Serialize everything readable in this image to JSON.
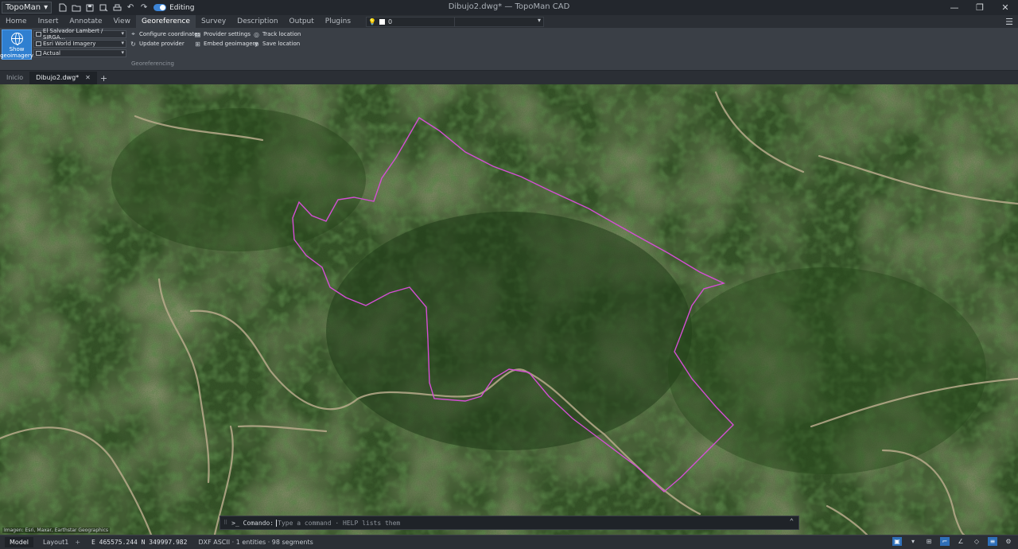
{
  "titlebar": {
    "app_menu": "TopoMan",
    "editing_label": "Editing",
    "window_title": "Dibujo2.dwg* — TopoMan CAD"
  },
  "ribbon_tabs": [
    "Home",
    "Insert",
    "Annotate",
    "View",
    "Georeference",
    "Survey",
    "Description",
    "Output",
    "Plugins"
  ],
  "active_tab": "Georeference",
  "layer_selector": {
    "value": "0"
  },
  "georeference": {
    "show_geoimagery": "Show geoimagery",
    "crs_combo": "El Salvador Lambert / SIRGA...",
    "provider_combo": "Esri World Imagery",
    "date_combo": "Actual",
    "configure_coordinates": "Configure coordinates",
    "update_provider": "Update provider",
    "provider_settings": "Provider settings",
    "embed_geoimagery": "Embed geoimagery",
    "track_location": "Track location",
    "save_location": "Save location",
    "group_label": "Georeferencing"
  },
  "doc_tabs": {
    "home": "Inicio",
    "active": "Dibujo2.dwg*"
  },
  "map": {
    "attribution": "Imagen: Esri, Maxar, Earthstar Geographics",
    "boundary_color": "#d44fd4"
  },
  "command": {
    "prompt": ">_ Comando:",
    "placeholder": "Type a command · HELP lists them"
  },
  "status": {
    "model_tab": "Model",
    "layout_tab": "Layout1",
    "coords": "E 465575.244  N 349997.982",
    "info": "DXF ASCII · 1 entities · 98 segments"
  }
}
